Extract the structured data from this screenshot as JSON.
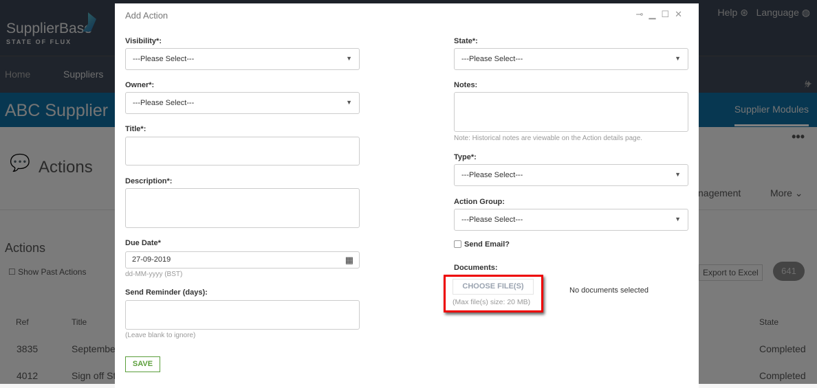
{
  "app": {
    "logo_text": "SupplierBase",
    "logo_sub": "STATE OF FLUX",
    "help": "Help",
    "language": "Language"
  },
  "nav": {
    "items": [
      "Home",
      "Suppliers"
    ]
  },
  "band": {
    "supplier": "ABC Supplier",
    "modules": "Supplier Modules"
  },
  "page": {
    "title": "Actions",
    "section": "Actions",
    "tab_partial": "nagement",
    "more": "More",
    "show_past": "Show Past Actions",
    "export": "Export to Excel",
    "count": "641",
    "columns": [
      "Ref",
      "Title",
      "State"
    ],
    "rows": [
      {
        "ref": "3835",
        "title": "Septembe",
        "state": "Completed"
      },
      {
        "ref": "4012",
        "title": "Sign off St",
        "state": "Completed"
      }
    ]
  },
  "modal": {
    "title": "Add Action",
    "visibility": {
      "label": "Visibility*:",
      "value": "---Please Select---"
    },
    "owner": {
      "label": "Owner*:",
      "value": "---Please Select---"
    },
    "title_field": {
      "label": "Title*:",
      "value": ""
    },
    "description": {
      "label": "Description*:",
      "value": ""
    },
    "due_date": {
      "label": "Due Date*",
      "value": "27-09-2019",
      "hint": "dd-MM-yyyy (BST)"
    },
    "reminder": {
      "label": "Send Reminder (days):",
      "value": "",
      "hint": "(Leave blank to ignore)"
    },
    "save": "SAVE",
    "state": {
      "label": "State*:",
      "value": "---Please Select---"
    },
    "notes": {
      "label": "Notes:",
      "value": "",
      "hint": "Note: Historical notes are viewable on the Action details page."
    },
    "type": {
      "label": "Type*:",
      "value": "---Please Select---"
    },
    "action_group": {
      "label": "Action Group:",
      "value": "---Please Select---"
    },
    "send_email": "Send Email?",
    "documents": {
      "label": "Documents:",
      "button": "CHOOSE FILE(S)",
      "max": "(Max file(s) size: 20 MB)",
      "status": "No documents selected"
    }
  }
}
